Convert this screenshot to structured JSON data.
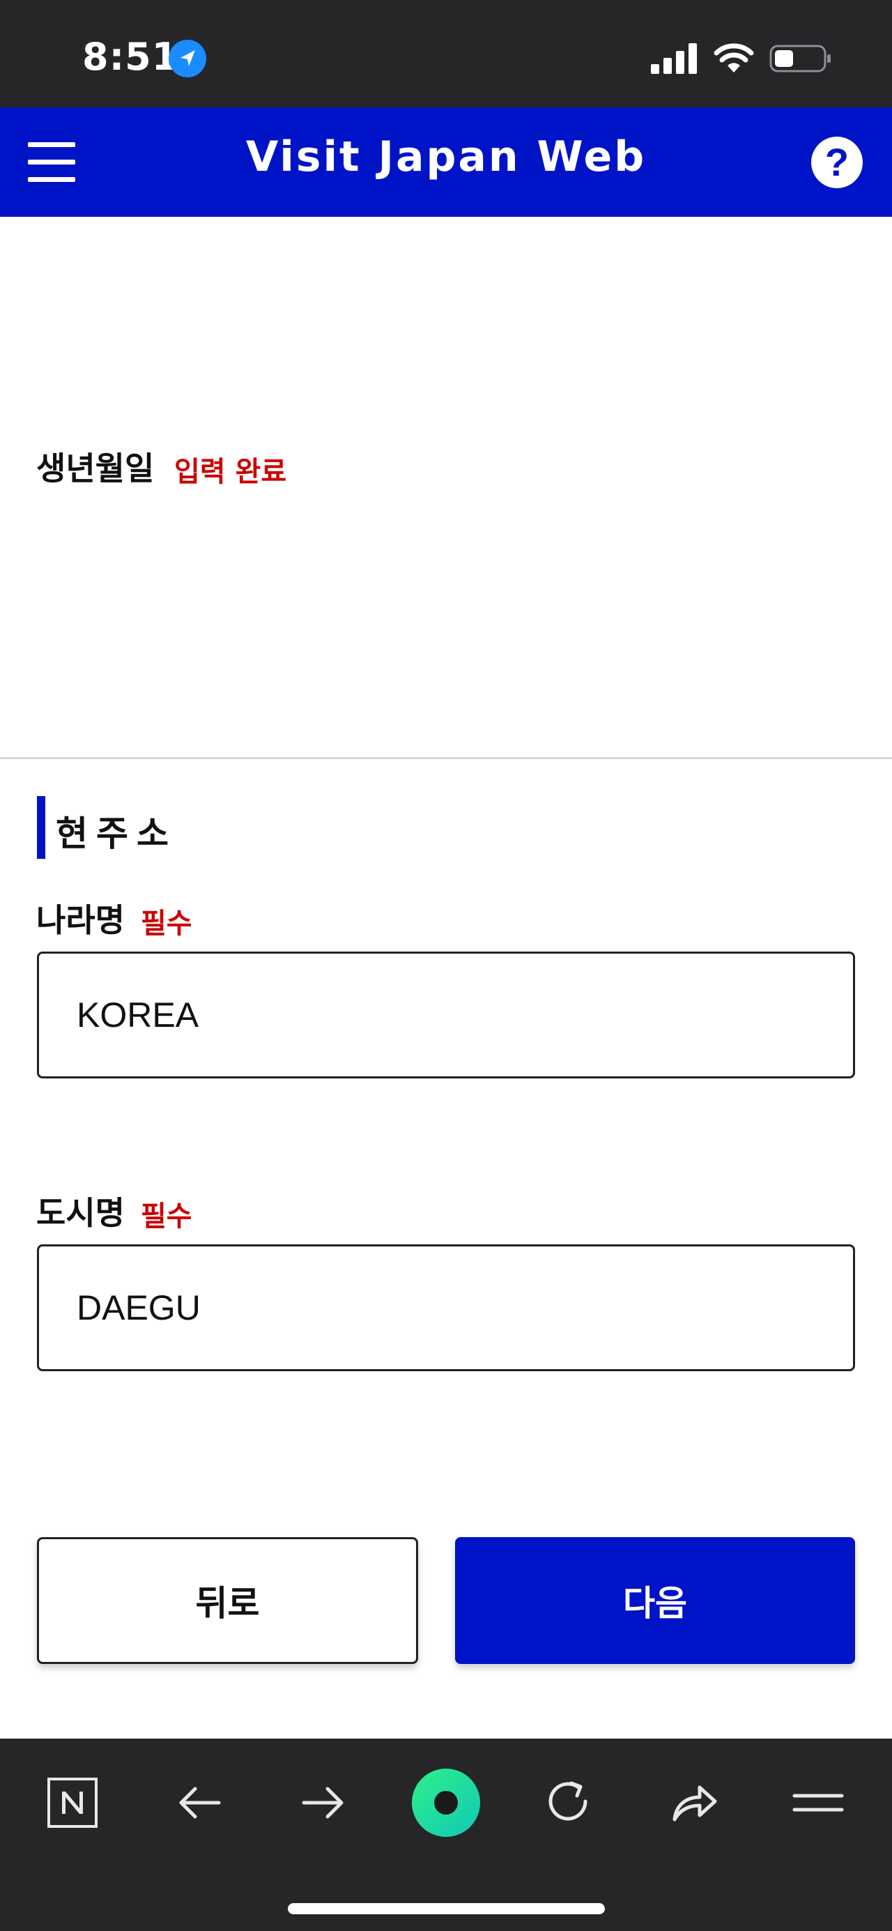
{
  "status_bar": {
    "time": "8:51"
  },
  "header": {
    "title": "Visit Japan Web"
  },
  "birth_date": {
    "label": "생년월일",
    "status": "입력 완료"
  },
  "section": {
    "title": "현주소"
  },
  "fields": {
    "country": {
      "label": "나라명",
      "required": "필수",
      "value": "KOREA"
    },
    "city": {
      "label": "도시명",
      "required": "필수",
      "value": "DAEGU"
    }
  },
  "buttons": {
    "back": "뒤로",
    "next": "다음"
  },
  "colors": {
    "brand_blue": "#0014c7",
    "required_red": "#cc0000",
    "bar_dark": "#262628",
    "whale_green": "#1ee29a"
  },
  "icons": {
    "status": [
      "location-arrow-icon",
      "signal-icon",
      "wifi-icon",
      "battery-icon"
    ],
    "header": [
      "menu-icon",
      "help-icon"
    ],
    "browser": [
      "naver-icon",
      "back-arrow-icon",
      "forward-arrow-icon",
      "whale-home-icon",
      "reload-icon",
      "share-icon",
      "browser-menu-icon"
    ]
  }
}
